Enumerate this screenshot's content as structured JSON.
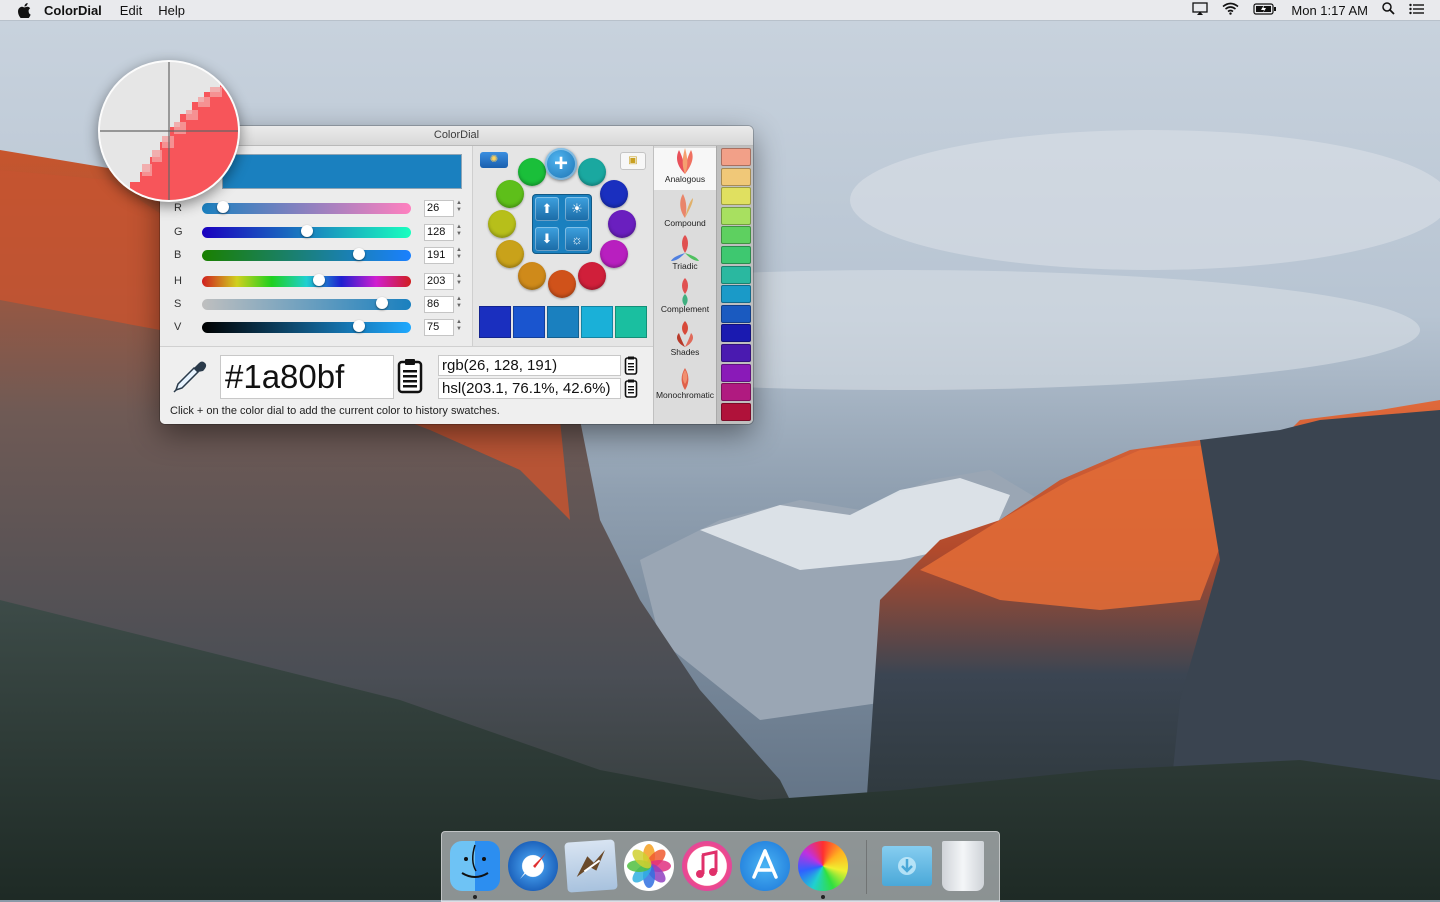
{
  "menubar": {
    "app_name": "ColorDial",
    "menus": [
      "Edit",
      "Help"
    ],
    "clock": "Mon 1:17 AM",
    "status_icons": [
      "airplay-icon",
      "wifi-icon",
      "battery-icon",
      "spotlight-icon",
      "notification-center-icon"
    ]
  },
  "window": {
    "title": "ColorDial",
    "current_color": "#1a80bf",
    "sliders": [
      {
        "label": "R",
        "value": "26",
        "fraction": 0.1
      },
      {
        "label": "G",
        "value": "128",
        "fraction": 0.5
      },
      {
        "label": "B",
        "value": "191",
        "fraction": 0.75
      },
      {
        "label": "H",
        "value": "203",
        "fraction": 0.56
      },
      {
        "label": "S",
        "value": "86",
        "fraction": 0.86
      },
      {
        "label": "V",
        "value": "75",
        "fraction": 0.75
      }
    ],
    "hex": "#1a80bf",
    "rgb": "rgb(26, 128, 191)",
    "hsl": "hsl(203.1, 76.1%, 42.6%)",
    "hint": "Click + on the color dial to add the current color to history swatches.",
    "dial_colors": [
      "#1aa8a0",
      "#1a2fbf",
      "#6a1fbf",
      "#b81fbf",
      "#d01f3a",
      "#d0521a",
      "#cf8a1a",
      "#c9a21a",
      "#b7bf1a",
      "#5ebf1a",
      "#1abf3a",
      "#1abf8a"
    ],
    "plus_color": "#1a80bf",
    "bottom_swatches": [
      "#1a2fbf",
      "#1a55cf",
      "#1a80bf",
      "#1ab0d8",
      "#1abfa0"
    ],
    "harmonies": [
      {
        "label": "Analogous",
        "active": true
      },
      {
        "label": "Compound",
        "active": false
      },
      {
        "label": "Triadic",
        "active": false
      },
      {
        "label": "Complement",
        "active": false
      },
      {
        "label": "Shades",
        "active": false
      },
      {
        "label": "Monochromatic",
        "active": false
      }
    ],
    "history": [
      "#f2a088",
      "#f0c878",
      "#e0e060",
      "#a8e060",
      "#5ed060",
      "#3ec870",
      "#2ab8a0",
      "#1a9ac8",
      "#1a5ac0",
      "#1a1ab0",
      "#4a1ab0",
      "#8a1ab8",
      "#b01a80",
      "#b0123a"
    ]
  },
  "dock": {
    "apps": [
      "finder-icon",
      "safari-icon",
      "mail-icon",
      "photos-icon",
      "itunes-icon",
      "app-store-icon",
      "colordial-icon",
      "downloads-folder-icon",
      "trash-icon"
    ]
  }
}
